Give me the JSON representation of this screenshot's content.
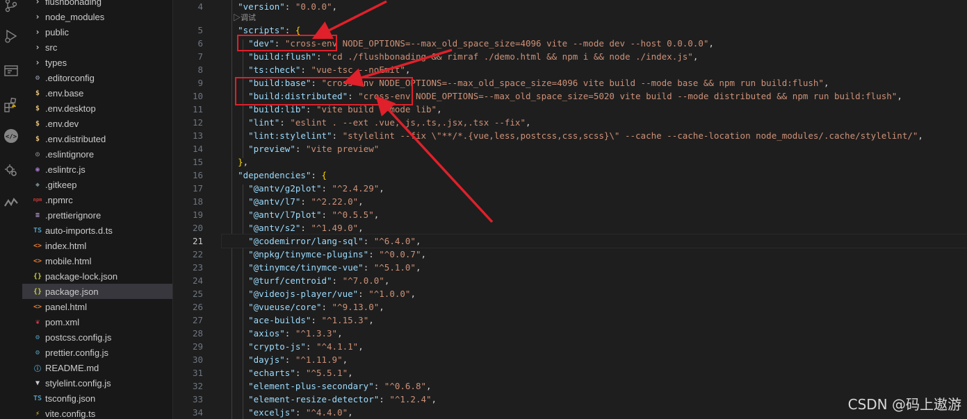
{
  "activity_bar": {
    "icons": [
      "source-control-icon",
      "run-debug-icon",
      "remote-explorer-icon",
      "extensions-icon",
      "chat-icon",
      "settings-sync-icon",
      "gitlens-icon"
    ],
    "warning_badge": "!"
  },
  "explorer": {
    "items": [
      {
        "label": "flushbonading",
        "type": "folder",
        "icon": "chevron-right-icon",
        "glyph": "›",
        "color": "#c5c5c5"
      },
      {
        "label": "node_modules",
        "type": "folder",
        "icon": "chevron-right-icon",
        "glyph": "›",
        "color": "#c5c5c5"
      },
      {
        "label": "public",
        "type": "folder",
        "icon": "chevron-right-icon",
        "glyph": "›",
        "color": "#c5c5c5"
      },
      {
        "label": "src",
        "type": "folder",
        "icon": "chevron-right-icon",
        "glyph": "›",
        "color": "#c5c5c5"
      },
      {
        "label": "types",
        "type": "folder",
        "icon": "chevron-right-icon",
        "glyph": "›",
        "color": "#c5c5c5"
      },
      {
        "label": ".editorconfig",
        "type": "file",
        "icon": "gear-icon",
        "glyph": "⚙",
        "color": "#9da5b4"
      },
      {
        "label": ".env.base",
        "type": "file",
        "icon": "dollar-icon",
        "glyph": "$",
        "color": "#e5c07b"
      },
      {
        "label": ".env.desktop",
        "type": "file",
        "icon": "dollar-icon",
        "glyph": "$",
        "color": "#e5c07b"
      },
      {
        "label": ".env.dev",
        "type": "file",
        "icon": "dollar-icon",
        "glyph": "$",
        "color": "#e5c07b"
      },
      {
        "label": ".env.distributed",
        "type": "file",
        "icon": "dollar-icon",
        "glyph": "$",
        "color": "#e5c07b"
      },
      {
        "label": ".eslintignore",
        "type": "file",
        "icon": "eslint-icon",
        "glyph": "◎",
        "color": "#8d8d8d"
      },
      {
        "label": ".eslintrc.js",
        "type": "file",
        "icon": "eslint-icon",
        "glyph": "◉",
        "color": "#a074c4"
      },
      {
        "label": ".gitkeep",
        "type": "file",
        "icon": "git-icon",
        "glyph": "◆",
        "color": "#6d8086"
      },
      {
        "label": ".npmrc",
        "type": "file",
        "icon": "npm-icon",
        "glyph": "npm",
        "color": "#cb3837"
      },
      {
        "label": ".prettierignore",
        "type": "file",
        "icon": "prettier-icon",
        "glyph": "≡",
        "color": "#c0a0e0"
      },
      {
        "label": "auto-imports.d.ts",
        "type": "file",
        "icon": "typescript-icon",
        "glyph": "TS",
        "color": "#519aba"
      },
      {
        "label": "index.html",
        "type": "file",
        "icon": "html-icon",
        "glyph": "<>",
        "color": "#e37933"
      },
      {
        "label": "mobile.html",
        "type": "file",
        "icon": "html-icon",
        "glyph": "<>",
        "color": "#e37933"
      },
      {
        "label": "package-lock.json",
        "type": "file",
        "icon": "json-icon",
        "glyph": "{}",
        "color": "#cbcb41"
      },
      {
        "label": "package.json",
        "type": "file",
        "icon": "json-icon",
        "glyph": "{}",
        "color": "#cbcb41",
        "selected": true
      },
      {
        "label": "panel.html",
        "type": "file",
        "icon": "html-icon",
        "glyph": "<>",
        "color": "#e37933"
      },
      {
        "label": "pom.xml",
        "type": "file",
        "icon": "maven-icon",
        "glyph": "❦",
        "color": "#cc3e44"
      },
      {
        "label": "postcss.config.js",
        "type": "file",
        "icon": "postcss-icon",
        "glyph": "⚙",
        "color": "#519aba"
      },
      {
        "label": "prettier.config.js",
        "type": "file",
        "icon": "settings-js-icon",
        "glyph": "⚙",
        "color": "#519aba"
      },
      {
        "label": "README.md",
        "type": "file",
        "icon": "info-icon",
        "glyph": "ⓘ",
        "color": "#519aba"
      },
      {
        "label": "stylelint.config.js",
        "type": "file",
        "icon": "stylelint-icon",
        "glyph": "▼",
        "color": "#cccccc"
      },
      {
        "label": "tsconfig.json",
        "type": "file",
        "icon": "tsconfig-icon",
        "glyph": "TS",
        "color": "#519aba"
      },
      {
        "label": "vite.config.ts",
        "type": "file",
        "icon": "vite-icon",
        "glyph": "⚡",
        "color": "#ffcf00"
      }
    ]
  },
  "editor": {
    "codelens": "▷调试",
    "active_line": 21,
    "lines": [
      {
        "n": "4",
        "t": [
          [
            "p",
            "  "
          ],
          [
            "k",
            "\"version\""
          ],
          [
            "p",
            ": "
          ],
          [
            "s",
            "\"0.0.0\""
          ],
          [
            "p",
            ","
          ]
        ]
      },
      {
        "n": "5",
        "t": [
          [
            "p",
            "  "
          ],
          [
            "k",
            "\"scripts\""
          ],
          [
            "p",
            ": "
          ],
          [
            "b2",
            "{"
          ]
        ]
      },
      {
        "n": "6",
        "t": [
          [
            "p",
            "    "
          ],
          [
            "k",
            "\"dev\""
          ],
          [
            "p",
            ": "
          ],
          [
            "s",
            "\"cross-env NODE_OPTIONS=--max_old_space_size=4096 vite --mode dev --host 0.0.0.0\""
          ],
          [
            "p",
            ","
          ]
        ]
      },
      {
        "n": "7",
        "t": [
          [
            "p",
            "    "
          ],
          [
            "k",
            "\"build:flush\""
          ],
          [
            "p",
            ": "
          ],
          [
            "s",
            "\"cd ./flushbonading && rimraf ./demo.html && npm i && node ./index.js\""
          ],
          [
            "p",
            ","
          ]
        ]
      },
      {
        "n": "8",
        "t": [
          [
            "p",
            "    "
          ],
          [
            "k",
            "\"ts:check\""
          ],
          [
            "p",
            ": "
          ],
          [
            "s",
            "\"vue-tsc --noEmit\""
          ],
          [
            "p",
            ","
          ]
        ]
      },
      {
        "n": "9",
        "t": [
          [
            "p",
            "    "
          ],
          [
            "k",
            "\"build:base\""
          ],
          [
            "p",
            ": "
          ],
          [
            "s",
            "\"cross-env NODE_OPTIONS=--max_old_space_size=4096 vite build --mode base && npm run build:flush\""
          ],
          [
            "p",
            ","
          ]
        ]
      },
      {
        "n": "10",
        "t": [
          [
            "p",
            "    "
          ],
          [
            "k",
            "\"build:distributed\""
          ],
          [
            "p",
            ": "
          ],
          [
            "s",
            "\"cross-env NODE_OPTIONS=--max_old_space_size=5020 vite build --mode distributed && npm run build:flush\""
          ],
          [
            "p",
            ","
          ]
        ]
      },
      {
        "n": "11",
        "t": [
          [
            "p",
            "    "
          ],
          [
            "k",
            "\"build:lib\""
          ],
          [
            "p",
            ": "
          ],
          [
            "s",
            "\"vite build --mode lib\""
          ],
          [
            "p",
            ","
          ]
        ]
      },
      {
        "n": "12",
        "t": [
          [
            "p",
            "    "
          ],
          [
            "k",
            "\"lint\""
          ],
          [
            "p",
            ": "
          ],
          [
            "s",
            "\"eslint . --ext .vue,.js,.ts,.jsx,.tsx --fix\""
          ],
          [
            "p",
            ","
          ]
        ]
      },
      {
        "n": "13",
        "t": [
          [
            "p",
            "    "
          ],
          [
            "k",
            "\"lint:stylelint\""
          ],
          [
            "p",
            ": "
          ],
          [
            "s",
            "\"stylelint --fix \\\"**/*.{vue,less,postcss,css,scss}\\\" --cache --cache-location node_modules/.cache/stylelint/\""
          ],
          [
            "p",
            ","
          ]
        ]
      },
      {
        "n": "14",
        "t": [
          [
            "p",
            "    "
          ],
          [
            "k",
            "\"preview\""
          ],
          [
            "p",
            ": "
          ],
          [
            "s",
            "\"vite preview\""
          ]
        ]
      },
      {
        "n": "15",
        "t": [
          [
            "p",
            "  "
          ],
          [
            "b2",
            "}"
          ],
          [
            "p",
            ","
          ]
        ]
      },
      {
        "n": "16",
        "t": [
          [
            "p",
            "  "
          ],
          [
            "k",
            "\"dependencies\""
          ],
          [
            "p",
            ": "
          ],
          [
            "b2",
            "{"
          ]
        ]
      },
      {
        "n": "17",
        "t": [
          [
            "p",
            "    "
          ],
          [
            "k",
            "\"@antv/g2plot\""
          ],
          [
            "p",
            ": "
          ],
          [
            "s",
            "\"^2.4.29\""
          ],
          [
            "p",
            ","
          ]
        ]
      },
      {
        "n": "18",
        "t": [
          [
            "p",
            "    "
          ],
          [
            "k",
            "\"@antv/l7\""
          ],
          [
            "p",
            ": "
          ],
          [
            "s",
            "\"^2.22.0\""
          ],
          [
            "p",
            ","
          ]
        ]
      },
      {
        "n": "19",
        "t": [
          [
            "p",
            "    "
          ],
          [
            "k",
            "\"@antv/l7plot\""
          ],
          [
            "p",
            ": "
          ],
          [
            "s",
            "\"^0.5.5\""
          ],
          [
            "p",
            ","
          ]
        ]
      },
      {
        "n": "20",
        "t": [
          [
            "p",
            "    "
          ],
          [
            "k",
            "\"@antv/s2\""
          ],
          [
            "p",
            ": "
          ],
          [
            "s",
            "\"^1.49.0\""
          ],
          [
            "p",
            ","
          ]
        ]
      },
      {
        "n": "21",
        "t": [
          [
            "p",
            "    "
          ],
          [
            "k",
            "\"@codemirror/lang-sql\""
          ],
          [
            "p",
            ": "
          ],
          [
            "s",
            "\"^6.4.0\""
          ],
          [
            "p",
            ","
          ]
        ]
      },
      {
        "n": "22",
        "t": [
          [
            "p",
            "    "
          ],
          [
            "k",
            "\"@npkg/tinymce-plugins\""
          ],
          [
            "p",
            ": "
          ],
          [
            "s",
            "\"^0.0.7\""
          ],
          [
            "p",
            ","
          ]
        ]
      },
      {
        "n": "23",
        "t": [
          [
            "p",
            "    "
          ],
          [
            "k",
            "\"@tinymce/tinymce-vue\""
          ],
          [
            "p",
            ": "
          ],
          [
            "s",
            "\"^5.1.0\""
          ],
          [
            "p",
            ","
          ]
        ]
      },
      {
        "n": "24",
        "t": [
          [
            "p",
            "    "
          ],
          [
            "k",
            "\"@turf/centroid\""
          ],
          [
            "p",
            ": "
          ],
          [
            "s",
            "\"^7.0.0\""
          ],
          [
            "p",
            ","
          ]
        ]
      },
      {
        "n": "25",
        "t": [
          [
            "p",
            "    "
          ],
          [
            "k",
            "\"@videojs-player/vue\""
          ],
          [
            "p",
            ": "
          ],
          [
            "s",
            "\"^1.0.0\""
          ],
          [
            "p",
            ","
          ]
        ]
      },
      {
        "n": "26",
        "t": [
          [
            "p",
            "    "
          ],
          [
            "k",
            "\"@vueuse/core\""
          ],
          [
            "p",
            ": "
          ],
          [
            "s",
            "\"^9.13.0\""
          ],
          [
            "p",
            ","
          ]
        ]
      },
      {
        "n": "27",
        "t": [
          [
            "p",
            "    "
          ],
          [
            "k",
            "\"ace-builds\""
          ],
          [
            "p",
            ": "
          ],
          [
            "s",
            "\"^1.15.3\""
          ],
          [
            "p",
            ","
          ]
        ]
      },
      {
        "n": "28",
        "t": [
          [
            "p",
            "    "
          ],
          [
            "k",
            "\"axios\""
          ],
          [
            "p",
            ": "
          ],
          [
            "s",
            "\"^1.3.3\""
          ],
          [
            "p",
            ","
          ]
        ]
      },
      {
        "n": "29",
        "t": [
          [
            "p",
            "    "
          ],
          [
            "k",
            "\"crypto-js\""
          ],
          [
            "p",
            ": "
          ],
          [
            "s",
            "\"^4.1.1\""
          ],
          [
            "p",
            ","
          ]
        ]
      },
      {
        "n": "30",
        "t": [
          [
            "p",
            "    "
          ],
          [
            "k",
            "\"dayjs\""
          ],
          [
            "p",
            ": "
          ],
          [
            "s",
            "\"^1.11.9\""
          ],
          [
            "p",
            ","
          ]
        ]
      },
      {
        "n": "31",
        "t": [
          [
            "p",
            "    "
          ],
          [
            "k",
            "\"echarts\""
          ],
          [
            "p",
            ": "
          ],
          [
            "s",
            "\"^5.5.1\""
          ],
          [
            "p",
            ","
          ]
        ]
      },
      {
        "n": "32",
        "t": [
          [
            "p",
            "    "
          ],
          [
            "k",
            "\"element-plus-secondary\""
          ],
          [
            "p",
            ": "
          ],
          [
            "s",
            "\"^0.6.8\""
          ],
          [
            "p",
            ","
          ]
        ]
      },
      {
        "n": "33",
        "t": [
          [
            "p",
            "    "
          ],
          [
            "k",
            "\"element-resize-detector\""
          ],
          [
            "p",
            ": "
          ],
          [
            "s",
            "\"^1.2.4\""
          ],
          [
            "p",
            ","
          ]
        ]
      },
      {
        "n": "34",
        "t": [
          [
            "p",
            "    "
          ],
          [
            "k",
            "\"exceljs\""
          ],
          [
            "p",
            ": "
          ],
          [
            "s",
            "\"^4.4.0\""
          ],
          [
            "p",
            ","
          ]
        ]
      }
    ]
  },
  "annotation": {
    "color": "#e0202a"
  },
  "watermark": "CSDN @码上遨游"
}
